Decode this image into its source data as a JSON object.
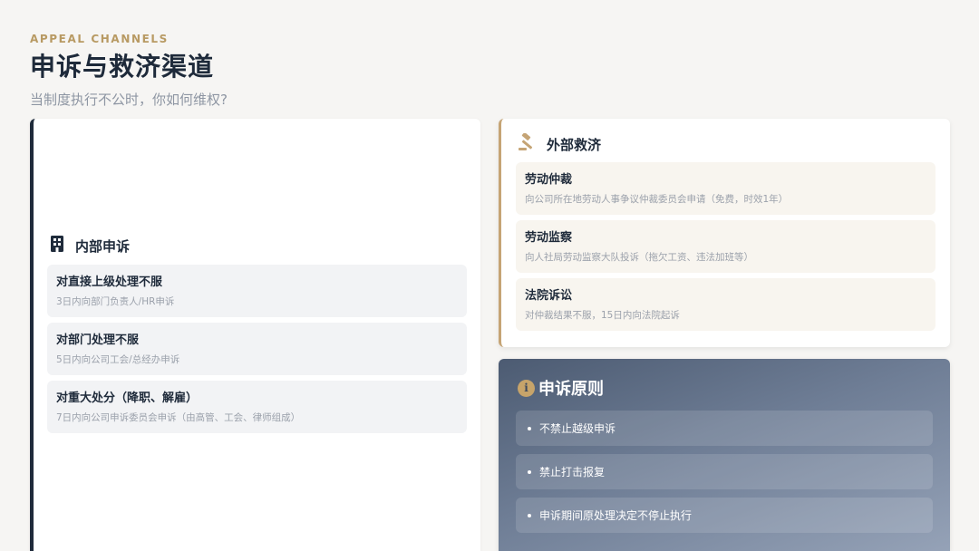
{
  "header": {
    "eyebrow": "APPEAL CHANNELS",
    "title": "申诉与救济渠道",
    "subtitle": "当制度执行不公时，你如何维权?"
  },
  "internal": {
    "title": "内部申诉",
    "icon": "building-icon",
    "items": [
      {
        "title": "对直接上级处理不服",
        "desc": "3日内向部门负责人/HR申诉"
      },
      {
        "title": "对部门处理不服",
        "desc": "5日内向公司工会/总经办申诉"
      },
      {
        "title": "对重大处分（降职、解雇）",
        "desc": "7日内向公司申诉委员会申诉（由高管、工会、律师组成）"
      }
    ]
  },
  "external": {
    "title": "外部救济",
    "icon": "gavel-icon",
    "items": [
      {
        "title": "劳动仲裁",
        "desc": "向公司所在地劳动人事争议仲裁委员会申请（免费，时效1年）"
      },
      {
        "title": "劳动监察",
        "desc": "向人社局劳动监察大队投诉（拖欠工资、违法加班等）"
      },
      {
        "title": "法院诉讼",
        "desc": "对仲裁结果不服，15日内向法院起诉"
      }
    ]
  },
  "principles": {
    "title": "申诉原则",
    "icon": "info-icon",
    "icon_glyph": "i",
    "items": [
      "不禁止越级申诉",
      "禁止打击报复",
      "申诉期间原处理决定不停止执行"
    ]
  },
  "colors": {
    "accent_gold": "#c5a475",
    "navy": "#1f2b3b",
    "background": "#f6f5f3"
  }
}
